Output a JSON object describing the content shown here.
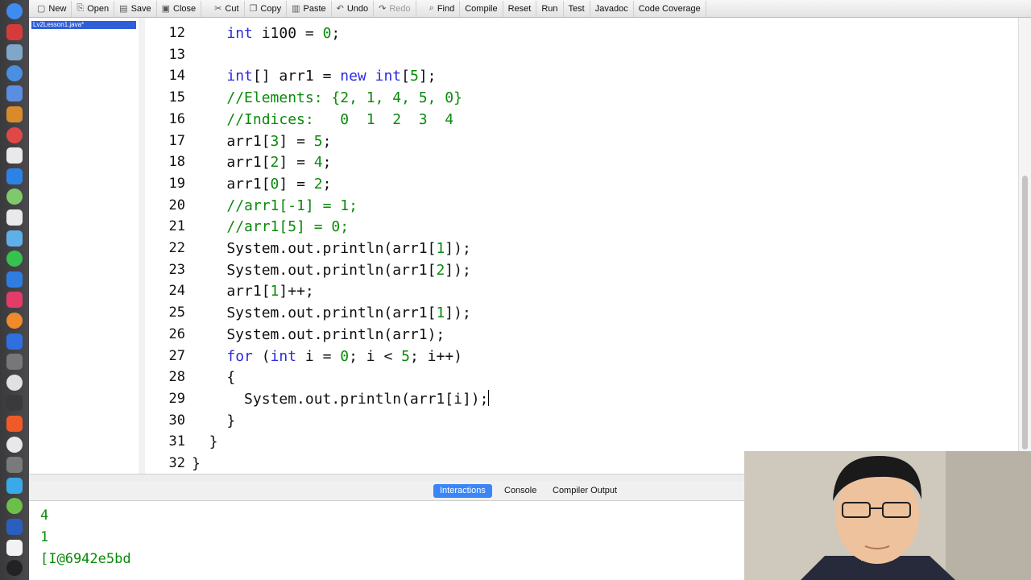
{
  "toolbar": {
    "buttons": [
      {
        "label": "New",
        "icon": "new-file-icon",
        "enabled": true
      },
      {
        "label": "Open",
        "icon": "open-folder-icon",
        "enabled": true
      },
      {
        "label": "Save",
        "icon": "save-icon",
        "enabled": true
      },
      {
        "label": "Close",
        "icon": "close-file-icon",
        "enabled": true
      },
      {
        "label": "Cut",
        "icon": "scissors-icon",
        "enabled": true
      },
      {
        "label": "Copy",
        "icon": "copy-icon",
        "enabled": true
      },
      {
        "label": "Paste",
        "icon": "paste-icon",
        "enabled": true
      },
      {
        "label": "Undo",
        "icon": "undo-icon",
        "enabled": true
      },
      {
        "label": "Redo",
        "icon": "redo-icon",
        "enabled": false
      },
      {
        "label": "Find",
        "icon": "binoculars-icon",
        "enabled": true
      },
      {
        "label": "Compile",
        "enabled": true
      },
      {
        "label": "Reset",
        "enabled": true
      },
      {
        "label": "Run",
        "enabled": true
      },
      {
        "label": "Test",
        "enabled": true
      },
      {
        "label": "Javadoc",
        "enabled": true
      },
      {
        "label": "Code Coverage",
        "enabled": true
      }
    ]
  },
  "files": {
    "selected": "Lv2Lesson1.java*"
  },
  "editor": {
    "lines": [
      {
        "n": "12",
        "text": "    int i100 = 0;"
      },
      {
        "n": "13",
        "text": ""
      },
      {
        "n": "14",
        "text": "    int[] arr1 = new int[5];"
      },
      {
        "n": "15",
        "text": "    //Elements: {2, 1, 4, 5, 0}"
      },
      {
        "n": "16",
        "text": "    //Indices:   0  1  2  3  4"
      },
      {
        "n": "17",
        "text": "    arr1[3] = 5;"
      },
      {
        "n": "18",
        "text": "    arr1[2] = 4;"
      },
      {
        "n": "19",
        "text": "    arr1[0] = 2;"
      },
      {
        "n": "20",
        "text": "    //arr1[-1] = 1;"
      },
      {
        "n": "21",
        "text": "    //arr1[5] = 0;"
      },
      {
        "n": "22",
        "text": "    System.out.println(arr1[1]);"
      },
      {
        "n": "23",
        "text": "    System.out.println(arr1[2]);"
      },
      {
        "n": "24",
        "text": "    arr1[1]++;"
      },
      {
        "n": "25",
        "text": "    System.out.println(arr1[1]);"
      },
      {
        "n": "26",
        "text": "    System.out.println(arr1);"
      },
      {
        "n": "27",
        "text": "    for (int i = 0; i < 5; i++)"
      },
      {
        "n": "28",
        "text": "    {"
      },
      {
        "n": "29",
        "text": "      System.out.println(arr1[i]);"
      },
      {
        "n": "30",
        "text": "    }"
      },
      {
        "n": "31",
        "text": "  }"
      },
      {
        "n": "32",
        "text": "}"
      }
    ]
  },
  "bottom_tabs": [
    {
      "label": "Interactions",
      "active": true
    },
    {
      "label": "Console",
      "active": false
    },
    {
      "label": "Compiler Output",
      "active": false
    }
  ],
  "console_output": [
    "4",
    "1",
    "[I@6942e5bd"
  ],
  "colors": {
    "keyword": "#2b2bdc",
    "number": "#0a8a0a",
    "comment": "#0a8a0a",
    "selection": "#2f5fd8",
    "active_tab": "#3b86f7"
  }
}
